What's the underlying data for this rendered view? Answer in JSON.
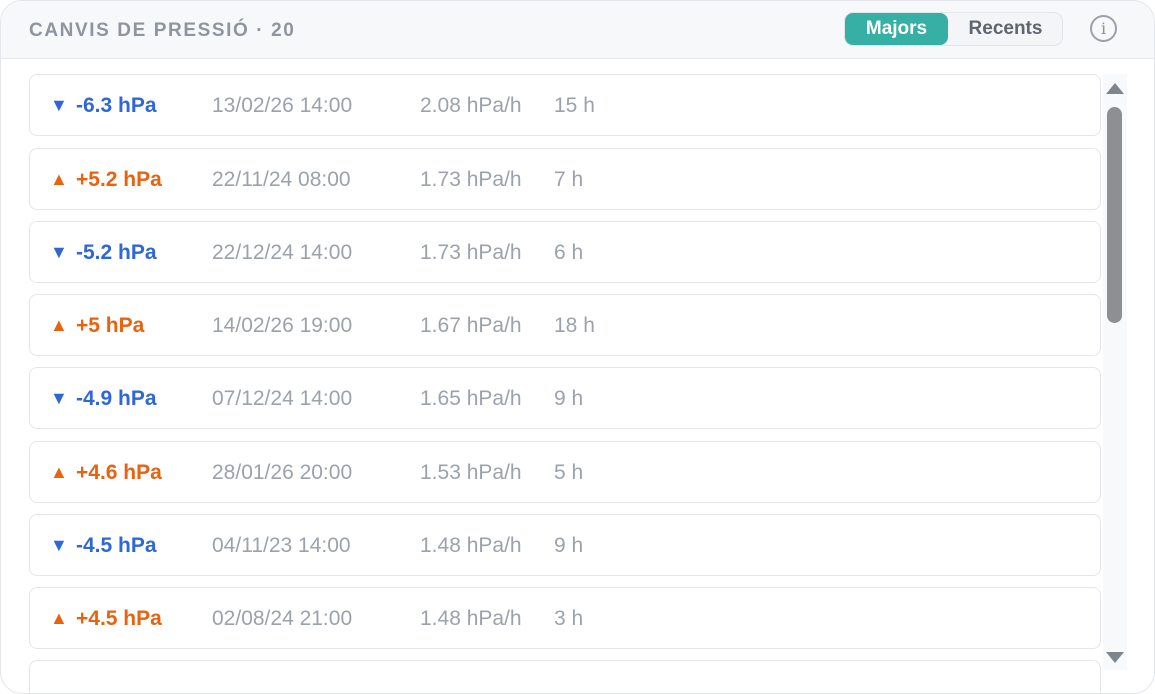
{
  "header": {
    "title": "CANVIS DE PRESSIÓ · 20",
    "tabs": [
      {
        "label": "Majors",
        "active": true
      },
      {
        "label": "Recents",
        "active": false
      }
    ],
    "info_icon": "i"
  },
  "colors": {
    "accent": "#36b0a5",
    "fall": "#2f67d6",
    "rise": "#e8620f",
    "muted": "#9ca2ab"
  },
  "icons": {
    "fall": "triangle-down",
    "rise": "triangle-up",
    "info": "info-circle"
  },
  "rows": [
    {
      "dir": "down",
      "arrow": "▼",
      "change": "-6.3 hPa",
      "date": "13/02/26 14:00",
      "rate": "2.08 hPa/h",
      "duration": "15 h"
    },
    {
      "dir": "up",
      "arrow": "▲",
      "change": "+5.2 hPa",
      "date": "22/11/24 08:00",
      "rate": "1.73 hPa/h",
      "duration": "7 h"
    },
    {
      "dir": "down",
      "arrow": "▼",
      "change": "-5.2 hPa",
      "date": "22/12/24 14:00",
      "rate": "1.73 hPa/h",
      "duration": "6 h"
    },
    {
      "dir": "up",
      "arrow": "▲",
      "change": "+5 hPa",
      "date": "14/02/26 19:00",
      "rate": "1.67 hPa/h",
      "duration": "18 h"
    },
    {
      "dir": "down",
      "arrow": "▼",
      "change": "-4.9 hPa",
      "date": "07/12/24 14:00",
      "rate": "1.65 hPa/h",
      "duration": "9 h"
    },
    {
      "dir": "up",
      "arrow": "▲",
      "change": "+4.6 hPa",
      "date": "28/01/26 20:00",
      "rate": "1.53 hPa/h",
      "duration": "5 h"
    },
    {
      "dir": "down",
      "arrow": "▼",
      "change": "-4.5 hPa",
      "date": "04/11/23 14:00",
      "rate": "1.48 hPa/h",
      "duration": "9 h"
    },
    {
      "dir": "up",
      "arrow": "▲",
      "change": "+4.5 hPa",
      "date": "02/08/24 21:00",
      "rate": "1.48 hPa/h",
      "duration": "3 h"
    }
  ]
}
